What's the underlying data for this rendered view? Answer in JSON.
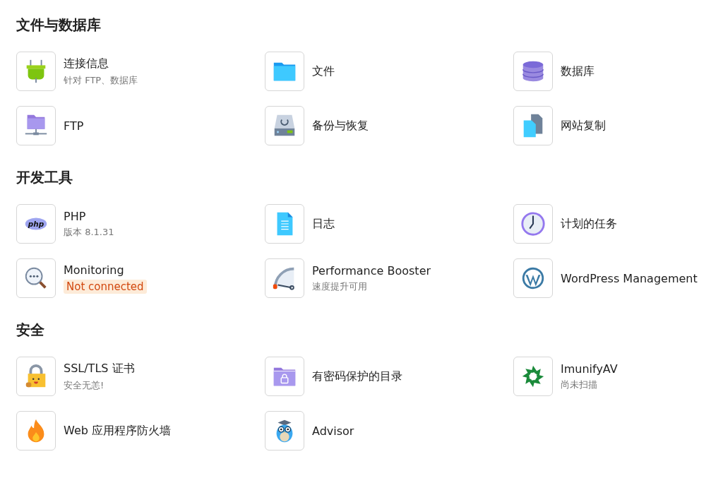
{
  "sections": [
    {
      "title": "文件与数据库",
      "items": [
        {
          "title": "连接信息",
          "note": {
            "kind": "plain",
            "text": "针对 FTP、数据库"
          }
        },
        {
          "title": "文件"
        },
        {
          "title": "数据库"
        },
        {
          "title": "FTP"
        },
        {
          "title": "备份与恢复"
        },
        {
          "title": "网站复制"
        }
      ]
    },
    {
      "title": "开发工具",
      "items": [
        {
          "title": "PHP",
          "logo_text": "php",
          "note": {
            "kind": "plain",
            "text": "版本 8.1.31"
          }
        },
        {
          "title": "日志"
        },
        {
          "title": "计划的任务"
        },
        {
          "title": "Monitoring",
          "note": {
            "kind": "warning",
            "text": "Not connected"
          }
        },
        {
          "title": "Performance Booster",
          "note": {
            "kind": "plain",
            "text": "速度提升可用"
          }
        },
        {
          "title": "WordPress Management"
        }
      ]
    },
    {
      "title": "安全",
      "items": [
        {
          "title": "SSL/TLS 证书",
          "note": {
            "kind": "plain",
            "text": "安全无恙!"
          }
        },
        {
          "title": "有密码保护的目录"
        },
        {
          "title": "ImunifyAV",
          "note": {
            "kind": "plain",
            "text": "尚未扫描"
          }
        },
        {
          "title": "Web 应用程序防火墙"
        },
        {
          "title": "Advisor"
        }
      ]
    }
  ]
}
